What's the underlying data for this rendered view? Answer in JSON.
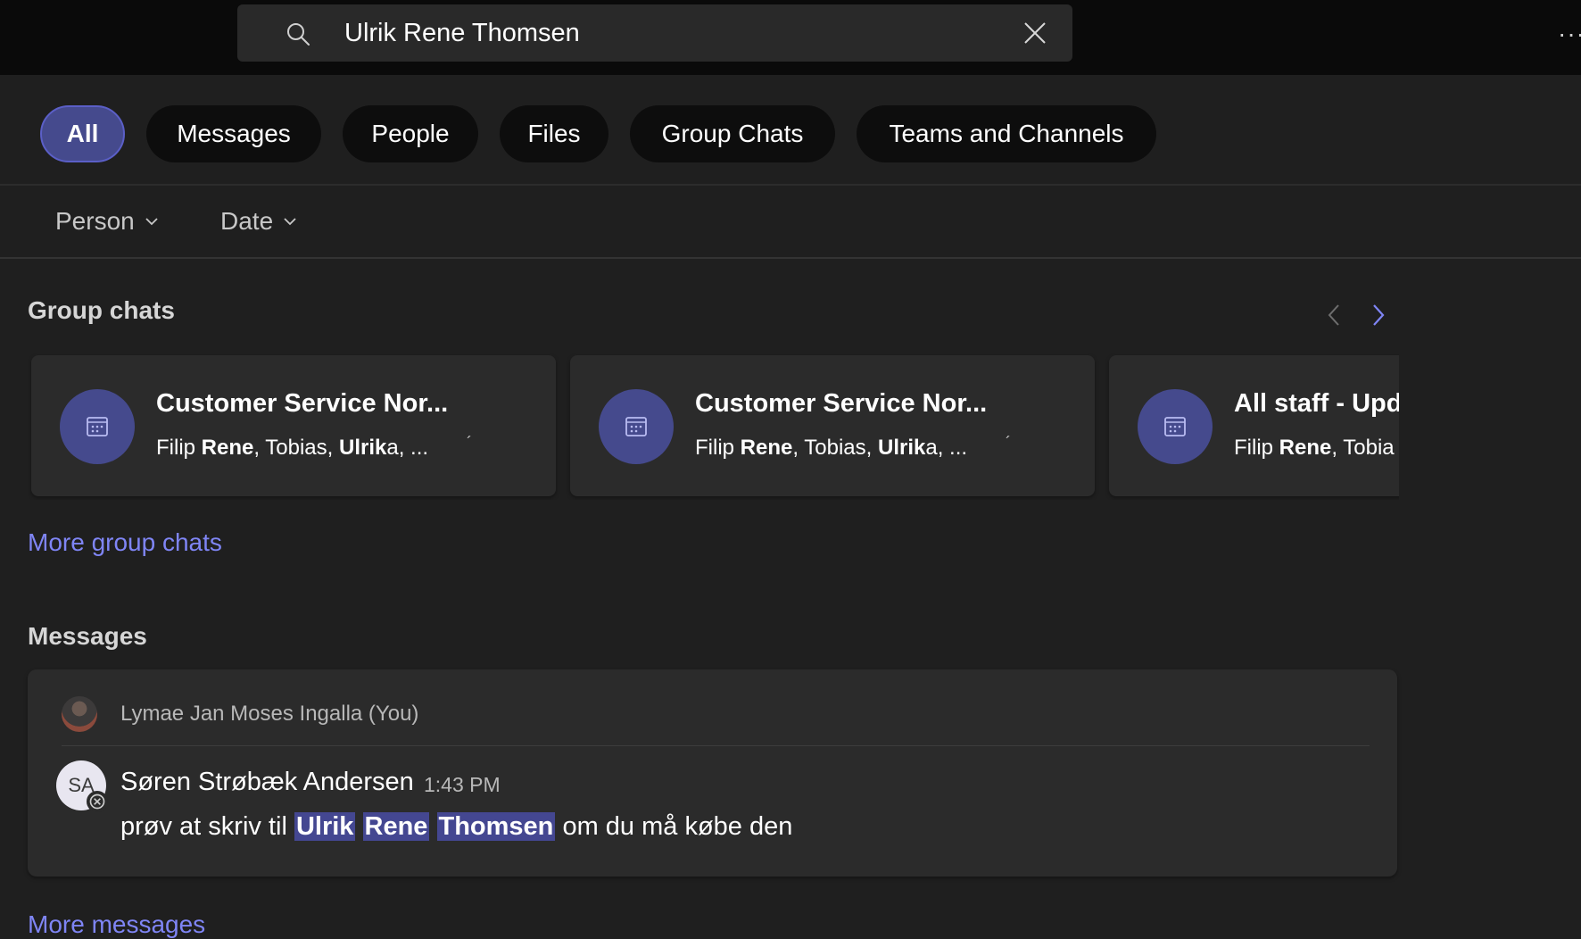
{
  "search": {
    "query": "Ulrik Rene Thomsen"
  },
  "filters": {
    "pills": [
      "All",
      "Messages",
      "People",
      "Files",
      "Group Chats",
      "Teams and Channels"
    ],
    "active": "All",
    "dropdowns": [
      "Person",
      "Date"
    ]
  },
  "group_chats": {
    "heading": "Group chats",
    "cards": [
      {
        "title": "Customer Service Nor...",
        "sub_pre": "Filip ",
        "sub_b1": "Rene",
        "sub_mid": ", Tobias, ",
        "sub_b2": "Ulrik",
        "sub_post": "a, ...",
        "tick": "´"
      },
      {
        "title": "Customer Service Nor...",
        "sub_pre": "Filip ",
        "sub_b1": "Rene",
        "sub_mid": ", Tobias, ",
        "sub_b2": "Ulrik",
        "sub_post": "a, ...",
        "tick": "´"
      },
      {
        "title": "All staff - Upd",
        "sub_pre": "Filip ",
        "sub_b1": "Rene",
        "sub_mid": ", Tobia",
        "sub_b2": "",
        "sub_post": "",
        "tick": ""
      }
    ],
    "more_link": "More group chats"
  },
  "messages": {
    "heading": "Messages",
    "items": [
      {
        "context_name": "Lymae Jan Moses Ingalla (You)",
        "sender_initials": "SA",
        "sender": "Søren Strøbæk Andersen",
        "time": "1:43 PM",
        "body_pre": "prøv at skriv til ",
        "hl1": "Ulrik",
        "hl2": "Rene",
        "hl3": "Thomsen",
        "body_post": " om du må købe den"
      }
    ],
    "more_link": "More messages"
  },
  "colors": {
    "accent": "#7f85f5",
    "active_pill": "#454a8d",
    "highlight": "#444791",
    "background": "#1f1f1f",
    "card": "#2b2b2b"
  },
  "icons": [
    "search-icon",
    "close-icon",
    "more-icon",
    "chevron-down-icon",
    "chevron-left-icon",
    "chevron-right-icon",
    "group-chat-icon",
    "status-offline-icon"
  ]
}
